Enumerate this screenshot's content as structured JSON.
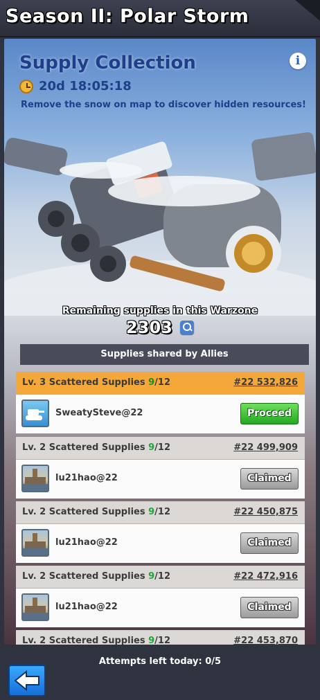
{
  "header": {
    "title": "Season II: Polar Storm"
  },
  "event": {
    "title": "Supply Collection",
    "timer": "20d 18:05:18",
    "description": "Remove the snow on map to discover hidden resources!",
    "remaining_label": "Remaining supplies in this Warzone",
    "remaining_value": "2303",
    "allies_label": "Supplies shared by Allies"
  },
  "supplies": [
    {
      "level": "Lv. 3 Scattered Supplies",
      "count": "9",
      "total": "/12",
      "coord": "#22 532,826",
      "player": "SweatySteve@22",
      "avatar": "tank",
      "button": "Proceed",
      "status": "proceed"
    },
    {
      "level": "Lv. 2 Scattered Supplies",
      "count": "9",
      "total": "/12",
      "coord": "#22 499,909",
      "player": "lu21hao@22",
      "avatar": "city",
      "button": "Claimed",
      "status": "claimed"
    },
    {
      "level": "Lv. 2 Scattered Supplies",
      "count": "9",
      "total": "/12",
      "coord": "#22 450,875",
      "player": "lu21hao@22",
      "avatar": "city",
      "button": "Claimed",
      "status": "claimed"
    },
    {
      "level": "Lv. 2 Scattered Supplies",
      "count": "9",
      "total": "/12",
      "coord": "#22 472,916",
      "player": "lu21hao@22",
      "avatar": "city",
      "button": "Claimed",
      "status": "claimed"
    },
    {
      "level": "Lv. 2 Scattered Supplies",
      "count": "9",
      "total": "/12",
      "coord": "#22 453,870"
    }
  ],
  "footer": {
    "attempts": "Attempts left today: 0/5"
  },
  "colors": {
    "highlight": "#f4a83a",
    "proceed": "#23a922",
    "title_blue": "#1f3f8a"
  },
  "icons": {
    "info": "info-icon",
    "clock": "clock-icon",
    "search": "search-icon",
    "back": "back-arrow-icon"
  }
}
